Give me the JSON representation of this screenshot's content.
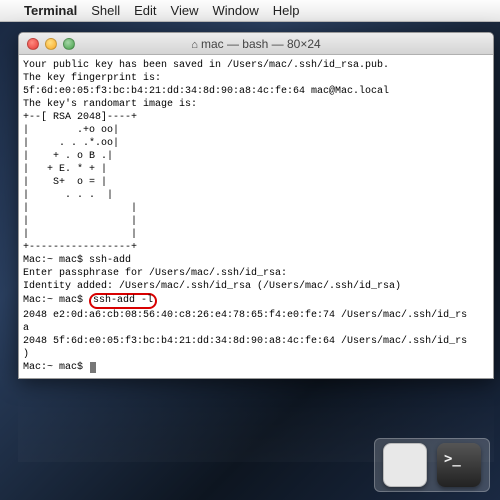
{
  "menubar": {
    "app": "Terminal",
    "items": [
      "Shell",
      "Edit",
      "View",
      "Window",
      "Help"
    ]
  },
  "window": {
    "title": "mac — bash — 80×24"
  },
  "terminal": {
    "line1": "Your public key has been saved in /Users/mac/.ssh/id_rsa.pub.",
    "line2": "The key fingerprint is:",
    "line3": "5f:6d:e0:05:f3:bc:b4:21:dd:34:8d:90:a8:4c:fe:64 mac@Mac.local",
    "line4": "The key's randomart image is:",
    "art0": "+--[ RSA 2048]----+",
    "art1": "|        .+o oo|",
    "art2": "|     . . .*.oo|",
    "art3": "|    + . o B .|",
    "art4": "|   + E. * + |",
    "art5": "|    S+  o = |",
    "art6": "|      . . .  |",
    "art7": "|                 |",
    "art8": "|                 |",
    "art9": "|                 |",
    "art10": "+-----------------+",
    "p1_prompt": "Mac:~ mac$ ",
    "p1_cmd": "ssh-add",
    "p2": "Enter passphrase for /Users/mac/.ssh/id_rsa:",
    "p3": "Identity added: /Users/mac/.ssh/id_rsa (/Users/mac/.ssh/id_rsa)",
    "p4_prompt": "Mac:~ mac$ ",
    "p4_cmd": "ssh-add -l",
    "p5": "2048 e2:0d:a6:cb:08:56:40:c8:26:e4:78:65:f4:e0:fe:74 /Users/mac/.ssh/id_rs",
    "p5b": "a",
    "p6": "2048 5f:6d:e0:05:f3:bc:b4:21:dd:34:8d:90:a8:4c:fe:64 /Users/mac/.ssh/id_rs",
    "p6b": ")",
    "p7_prompt": "Mac:~ mac$ "
  },
  "highlight_command": "ssh-add -l"
}
